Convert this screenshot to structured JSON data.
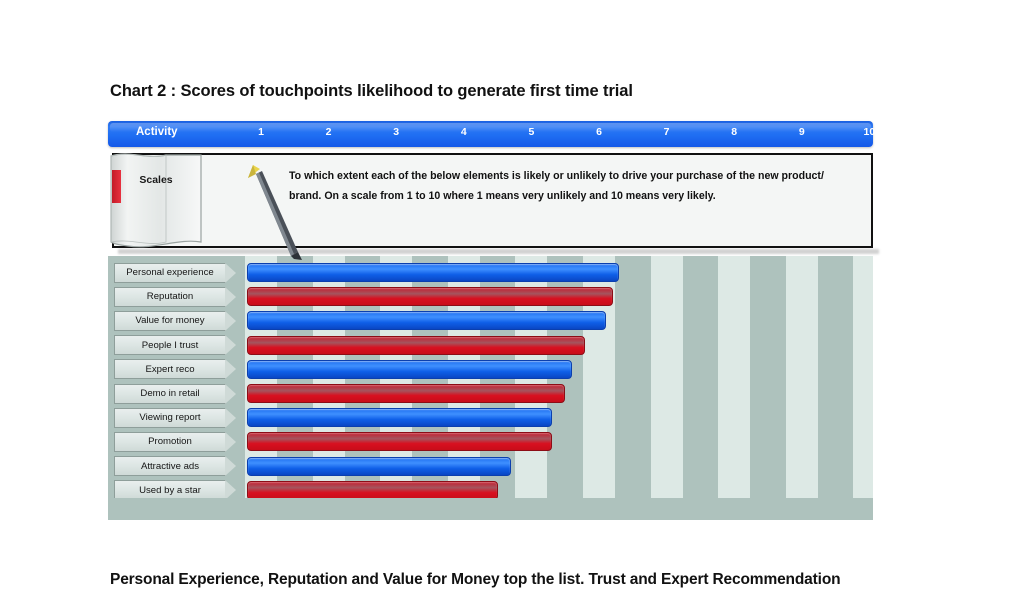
{
  "title": "Chart 2 : Scores of touchpoints likelihood to generate first time trial",
  "header": {
    "activity_label": "Activity",
    "scale_numbers": [
      "1",
      "2",
      "3",
      "4",
      "5",
      "6",
      "7",
      "8",
      "9",
      "10"
    ]
  },
  "scales_panel": {
    "book_label": "Scales",
    "question": "To which extent each of the below elements  is likely or unlikely to drive your purchase of the new product/ brand. On a scale from 1 to 10 where 1 means very unlikely and 10 means very likely.",
    "pencil_icon": "pencil-icon",
    "bookmark_icon": "bookmark-icon"
  },
  "footer": "Personal Experience, Reputation and Value for Money top the list.  Trust and Expert Recommendation",
  "colors": {
    "blue_bar": "#1f6ff0",
    "red_bar": "#d81020",
    "plot_background": "#aec2bd",
    "stripe": "#dde9e5",
    "header_blue": "#1f6ef2"
  },
  "chart_data": {
    "type": "bar",
    "orientation": "horizontal",
    "title": "Chart 2 : Scores of touchpoints likelihood to generate first time trial",
    "xlabel": "Activity",
    "ylabel": "",
    "xlim": [
      0,
      10
    ],
    "xticks": [
      1,
      2,
      3,
      4,
      5,
      6,
      7,
      8,
      9,
      10
    ],
    "grid": true,
    "legend": "none",
    "categories": [
      "Personal experience",
      "Reputation",
      "Value for money",
      "People I trust",
      "Expert reco",
      "Demo in retail",
      "Viewing report",
      "Promotion",
      "Attractive ads",
      "Used by a star"
    ],
    "values": [
      6.3,
      6.2,
      6.1,
      5.8,
      5.6,
      5.5,
      5.3,
      5.3,
      4.7,
      4.5
    ],
    "colors": [
      "blue",
      "red",
      "blue",
      "red",
      "blue",
      "red",
      "blue",
      "red",
      "blue",
      "red"
    ]
  }
}
